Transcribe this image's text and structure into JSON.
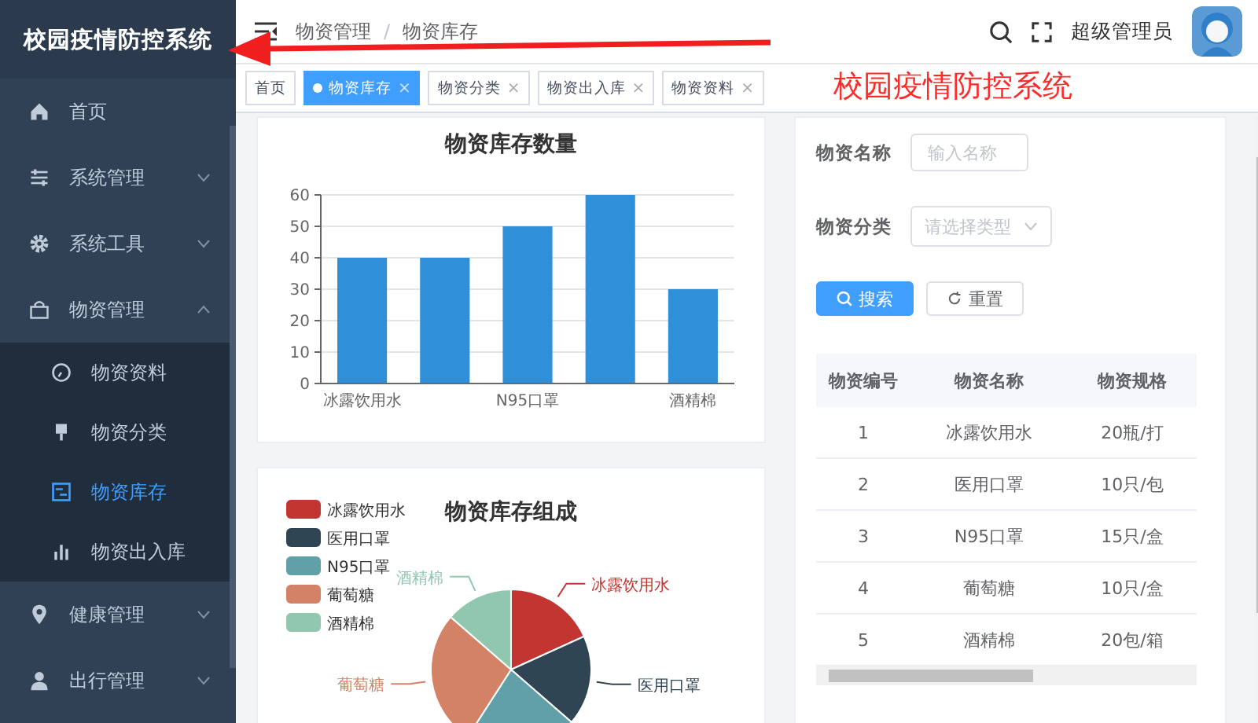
{
  "sidebar": {
    "logo": "校园疫情防控系统",
    "menu": [
      {
        "label": "首页",
        "kind": "item",
        "selected": false
      },
      {
        "label": "系统管理",
        "kind": "submenu",
        "expanded": false
      },
      {
        "label": "系统工具",
        "kind": "submenu",
        "expanded": false
      },
      {
        "label": "物资管理",
        "kind": "submenu",
        "expanded": true,
        "children": [
          {
            "label": "物资资料",
            "selected": false
          },
          {
            "label": "物资分类",
            "selected": false
          },
          {
            "label": "物资库存",
            "selected": true
          },
          {
            "label": "物资出入库",
            "selected": false
          }
        ]
      },
      {
        "label": "健康管理",
        "kind": "submenu",
        "expanded": false
      },
      {
        "label": "出行管理",
        "kind": "submenu",
        "expanded": false
      }
    ]
  },
  "header": {
    "breadcrumb": {
      "items": [
        "物资管理",
        "物资库存"
      ],
      "separator": "/"
    },
    "user": "超级管理员"
  },
  "tags": [
    {
      "label": "首页",
      "selected": false
    },
    {
      "label": "物资库存",
      "selected": true,
      "close": "×"
    },
    {
      "label": "物资分类",
      "selected": false,
      "close": "×"
    },
    {
      "label": "物资出入库",
      "selected": false,
      "close": "×"
    },
    {
      "label": "物资资料",
      "selected": false,
      "close": "×"
    }
  ],
  "bar_card": {
    "chart_data": {
      "type": "bar",
      "title": "物资库存数量",
      "values": [
        40,
        40,
        50,
        60,
        30
      ],
      "color": "#2f8fd8",
      "categories": [
        "冰露饮用水",
        null,
        "N95口罩",
        null,
        "酒精棉"
      ],
      "ylim": [
        0,
        60
      ],
      "yticks": [
        0,
        10,
        20,
        30,
        40,
        50,
        60
      ],
      "grid": true
    }
  },
  "pie_card": {
    "chart_data": {
      "type": "pie",
      "title": "物资库存组成",
      "categories": [
        "冰露饮用水",
        "医用口罩",
        "N95口罩",
        "葡萄糖",
        "酒精棉"
      ],
      "values": [
        18.2,
        18.2,
        22.7,
        27.3,
        13.6
      ],
      "colors": [
        "#c23531",
        "#2f4554",
        "#61a0a8",
        "#d48265",
        "#91c7ae"
      ],
      "legend": true
    }
  },
  "filter": {
    "fields": [
      {
        "label": "物资名称",
        "kind": "input",
        "placeholder": "输入名称"
      },
      {
        "label": "物资分类",
        "kind": "select",
        "placeholder": "请选择类型"
      }
    ],
    "buttons": [
      {
        "label": "搜索",
        "kind": "primary"
      },
      {
        "label": "重置",
        "kind": "default"
      }
    ]
  },
  "table": {
    "columns": [
      "物资编号",
      "物资名称",
      "物资规格"
    ],
    "rows": [
      [
        "1",
        "冰露饮用水",
        "20瓶/打"
      ],
      [
        "2",
        "医用口罩",
        "10只/包"
      ],
      [
        "3",
        "N95口罩",
        "15只/盒"
      ],
      [
        "4",
        "葡萄糖",
        "10只/盒"
      ],
      [
        "5",
        "酒精棉",
        "20包/箱"
      ]
    ]
  },
  "annotation": {
    "text": "校园疫情防控系统"
  }
}
